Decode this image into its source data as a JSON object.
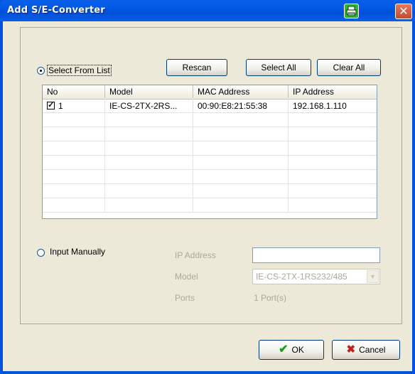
{
  "window": {
    "title": "Add S/E-Converter",
    "close_glyph": "✕"
  },
  "colors": {
    "titlebar": "#0058e6",
    "client": "#ece9d8",
    "ok_check": "#1e9a1e",
    "cancel_x": "#c0221a"
  },
  "icons": {
    "print": "printer-icon",
    "close": "close-icon",
    "ok": "check-icon",
    "cancel": "x-icon"
  },
  "select_from_list": {
    "label": "Select From List",
    "selected": true
  },
  "buttons": {
    "rescan": "Rescan",
    "select_all": "Select All",
    "clear_all": "Clear All",
    "ok": "OK",
    "cancel": "Cancel"
  },
  "table": {
    "headers": [
      "No",
      "Model",
      "MAC Address",
      "IP Address"
    ],
    "rows": [
      {
        "checked": true,
        "no": "1",
        "model": "IE-CS-2TX-2RS...",
        "mac": "00:90:E8:21:55:38",
        "ip": "192.168.1.110"
      }
    ]
  },
  "input_manually": {
    "label": "Input Manually",
    "selected": false,
    "ip_label": "IP Address",
    "ip_value": "",
    "model_label": "Model",
    "model_value": "IE-CS-2TX-1RS232/485",
    "ports_label": "Ports",
    "ports_value": "1 Port(s)"
  }
}
